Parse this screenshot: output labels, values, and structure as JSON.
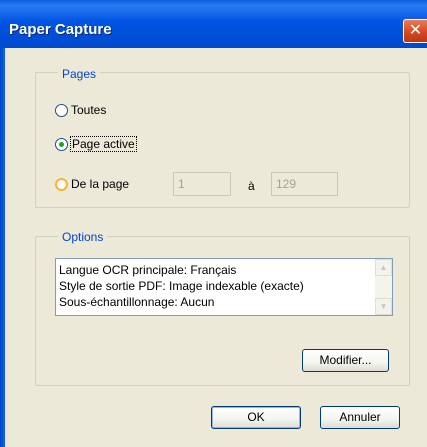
{
  "window": {
    "title": "Paper Capture",
    "close_glyph": "✕"
  },
  "pages": {
    "legend": "Pages",
    "options": [
      {
        "label": "Toutes",
        "checked": false
      },
      {
        "label": "Page active",
        "checked": true
      },
      {
        "label": "De la page",
        "checked": false
      }
    ],
    "from_value": "1",
    "to_label": "à",
    "to_value": "129"
  },
  "options": {
    "legend": "Options",
    "lines": [
      "Langue OCR principale: Français",
      "Style de sortie PDF: Image indexable (exacte)",
      "Sous-échantillonnage: Aucun"
    ],
    "modify_label": "Modifier..."
  },
  "footer": {
    "ok_label": "OK",
    "cancel_label": "Annuler"
  },
  "icons": {
    "scroll_up": "scroll-up-icon",
    "scroll_down": "scroll-down-icon",
    "close": "close-icon"
  }
}
